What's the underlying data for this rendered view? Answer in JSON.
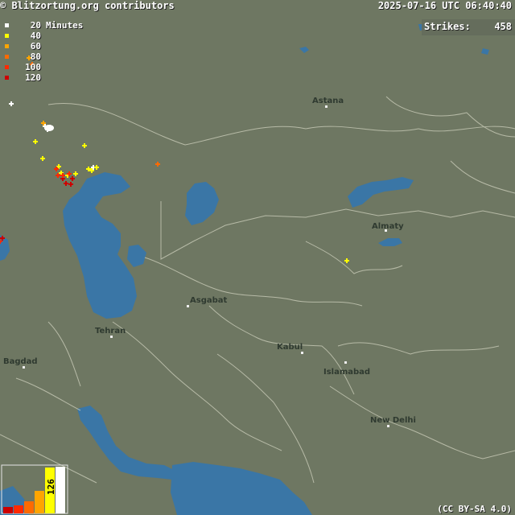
{
  "header": {
    "credit_left": "© Blitzortung.org contributors",
    "timestamp": "2025-07-16 UTC 06:40:40"
  },
  "strikes": {
    "label": "Strikes:",
    "value": "458"
  },
  "legend": {
    "unit": "Minutes",
    "items": [
      {
        "label": "20",
        "color": "#ffffff"
      },
      {
        "label": "40",
        "color": "#ffff00"
      },
      {
        "label": "60",
        "color": "#ffa500"
      },
      {
        "label": "80",
        "color": "#ff6a00"
      },
      {
        "label": "100",
        "color": "#ff2a00"
      },
      {
        "label": "120",
        "color": "#cc0000"
      }
    ]
  },
  "cities": [
    "Astana",
    "Almaty",
    "Asgabat",
    "Tehran",
    "Kabul",
    "Islamabad",
    "Bagdad",
    "New Delhi"
  ],
  "histogram": {
    "value_label": "126",
    "bars": [
      {
        "color": "#cc0000",
        "value": 0.13
      },
      {
        "color": "#ff2a00",
        "value": 0.18
      },
      {
        "color": "#ff6a00",
        "value": 0.25
      },
      {
        "color": "#ffa500",
        "value": 0.48
      },
      {
        "color": "#ffff00",
        "value": 0.98
      },
      {
        "color": "#ffffff",
        "value": 1.0
      }
    ]
  },
  "footer": {
    "license": "(CC BY-SA 4.0)"
  },
  "colors": {
    "land": "#6e7762",
    "water": "#3a76a6",
    "border": "#c9cbb8"
  }
}
